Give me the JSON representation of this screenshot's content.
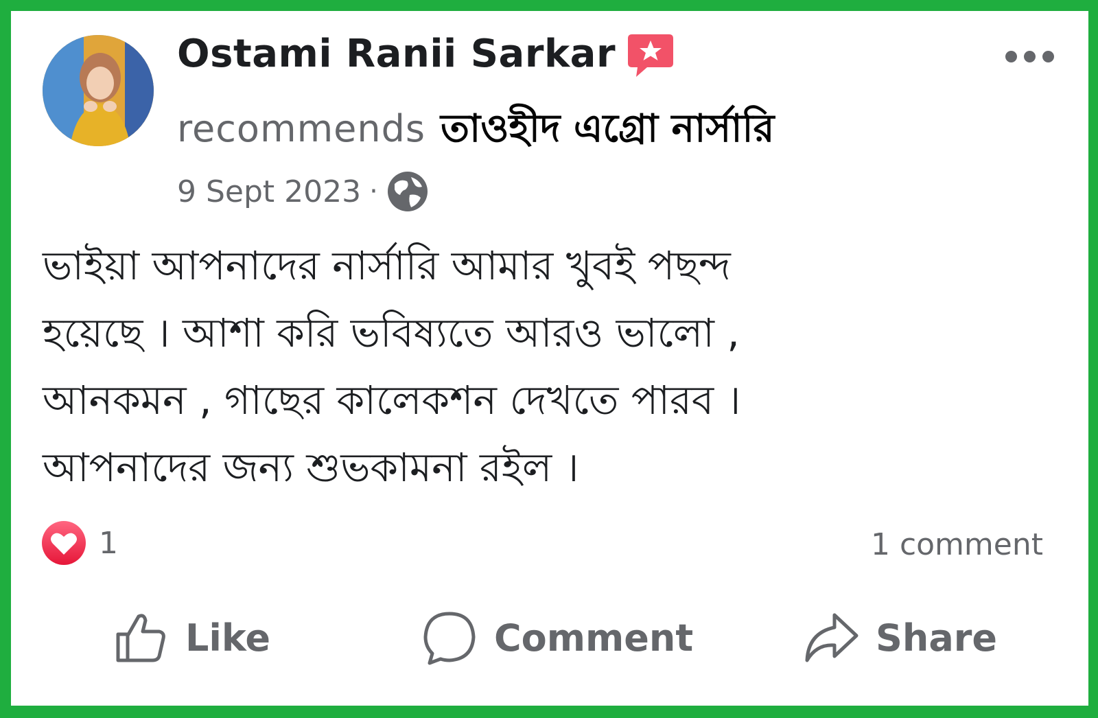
{
  "post": {
    "author_name": "Ostami Ranii Sarkar",
    "recommends_word": "recommends",
    "page_name": "তাওহীদ এগ্রো নার্সারি",
    "date": "9 Sept 2023",
    "dot": "·",
    "body": "ভাইয়া আপনাদের নার্সারি আমার খুবই পছন্দ\nহয়েছে । আশা করি ভবিষ্যতে আরও ভালো ,\nআনকমন , গাছের কালেকশন দেখতে পারব ।\nআপনাদের জন্য শুভকামনা রইল ।",
    "audience_icon": "globe-icon",
    "badge_icon": "recommendation-star-icon"
  },
  "reactions": {
    "icon": "love-reaction-icon",
    "count": "1",
    "comments": "1 comment"
  },
  "actions": {
    "like": "Like",
    "comment": "Comment",
    "share": "Share"
  },
  "colors": {
    "frame": "#1fae3f",
    "card": "#ffffff",
    "text_primary": "#1c1e21",
    "text_secondary": "#65676b",
    "badge": "#f25268",
    "love": "#f33e58"
  }
}
